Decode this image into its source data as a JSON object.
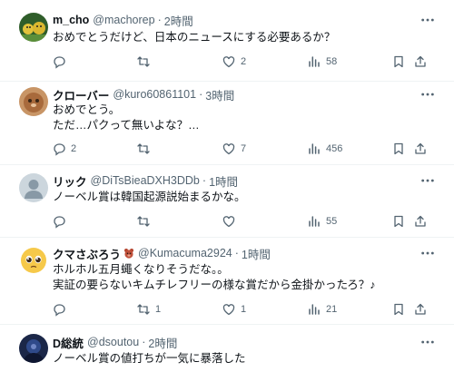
{
  "tweets": [
    {
      "name": "m_cho",
      "handle": "@machorep",
      "time": "2時間",
      "text": "おめでとうだけど、日本のニュースにする必要あるか？",
      "counts": {
        "reply": "",
        "retweet": "",
        "like": "2",
        "views": "58"
      },
      "avatar_icon": "avatar-group-photo",
      "avatar_color": "#3a6b35"
    },
    {
      "name": "クローバー",
      "handle": "@kuro60861101",
      "time": "3時間",
      "text": "おめでとう。\nただ…パクって無いよな？…",
      "counts": {
        "reply": "2",
        "retweet": "",
        "like": "7",
        "views": "456"
      },
      "avatar_icon": "avatar-cat-photo",
      "avatar_color": "#b07a4a"
    },
    {
      "name": "リック",
      "handle": "@DiTsBieaDXH3DDb",
      "time": "1時間",
      "text": "ノーベル賞は韓国起源説始まるかな。",
      "counts": {
        "reply": "",
        "retweet": "",
        "like": "",
        "views": "55"
      },
      "avatar_icon": "default-avatar-icon",
      "avatar_color": "#ccd6dd"
    },
    {
      "name": "クマさぶろう",
      "handle": "@Kumacuma2924",
      "time": "1時間",
      "text": "ホルホル五月蠅くなりそうだな。。\n実証の要らないキムチレフリーの様な賞だから金掛かったろ？♪",
      "counts": {
        "reply": "",
        "retweet": "1",
        "like": "1",
        "views": "21"
      },
      "avatar_icon": "avatar-pleading-face",
      "avatar_color": "#f4c542",
      "name_emoji": "bear-emoji-icon"
    },
    {
      "name": "D総統",
      "handle": "@dsoutou",
      "time": "2時間",
      "text": "ノーベル賞の値打ちが一気に暴落した",
      "counts": {
        "reply": "",
        "retweet": "",
        "like": "",
        "views": ""
      },
      "avatar_icon": "avatar-dark-photo",
      "avatar_color": "#1f2f5a"
    }
  ],
  "separator": "·",
  "colors": {
    "text": "#0f1419",
    "secondary": "#536471",
    "border": "#eff3f4"
  }
}
